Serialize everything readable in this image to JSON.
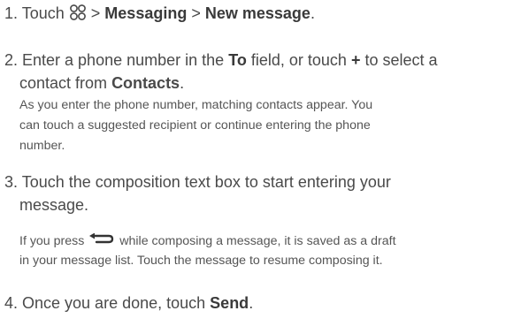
{
  "icons": {
    "apps": "apps-grid-icon",
    "back": "back-arrow-icon"
  },
  "step1": {
    "num": "1. Touch",
    "sep1": ">",
    "messaging": "Messaging",
    "sep2": ">",
    "new_message": "New message",
    "end": "."
  },
  "step2": {
    "line1_a": "2. Enter a phone number in the",
    "to": "To",
    "line1_b": "field, or touch",
    "plus": "+",
    "line1_c": "to select a",
    "line2_a": "contact from",
    "contacts": "Contacts",
    "line2_end": ".",
    "note_lines": [
      "As you enter the phone number, matching contacts appear. You",
      "can touch a suggested recipient or continue entering the phone",
      "number."
    ]
  },
  "step3": {
    "line1": "3. Touch the composition text box to start entering your",
    "line2": "message.",
    "note_line1_a": "If you press",
    "note_line1_b": "while composing a message, it is saved as a draft",
    "note_line2": "in your message list. Touch the message to resume composing it."
  },
  "step4": {
    "text": "4. Once you are done, touch",
    "send": "Send",
    "end": "."
  }
}
